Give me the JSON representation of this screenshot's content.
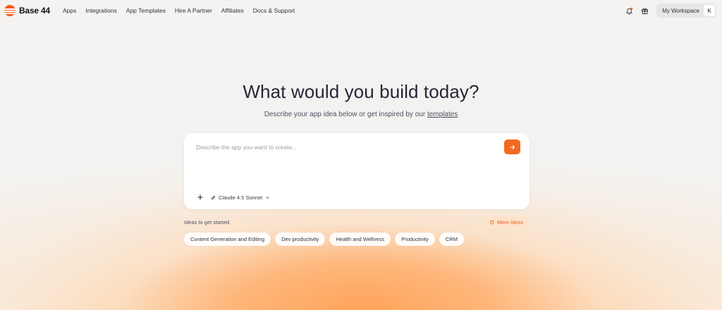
{
  "brand": {
    "name": "Base 44",
    "color": "#f25a1c"
  },
  "nav": {
    "links": [
      "Apps",
      "Integrations",
      "App Templates",
      "Hire A Partner",
      "Affiliates",
      "Docs & Support"
    ],
    "notification_icon": "bell-icon",
    "notification_dot_color": "#f25a1c",
    "gift_icon": "gift-icon",
    "workspace_label": "My Workspace",
    "avatar_initial": "K"
  },
  "hero": {
    "title": "What would you build today?",
    "subtitle_prefix": "Describe your app idea below or get inspired by our ",
    "subtitle_link": "templates"
  },
  "prompt": {
    "placeholder": "Describe the app you want to create...",
    "value": "",
    "send_icon": "arrow-right-icon",
    "accent_color": "#f26a1f",
    "add_icon": "plus-icon",
    "model_icon": "link-icon",
    "model": "Claude 4.5 Sonnet",
    "model_dropdown_icon": "chevron-down-icon"
  },
  "ideas": {
    "label": "Ideas to get started",
    "more_label": "More ideas",
    "more_icon": "refresh-icon",
    "chips": [
      "Content Generation and Editing",
      "Dev productivity",
      "Health and Wellness",
      "Productivity",
      "CRM"
    ]
  }
}
